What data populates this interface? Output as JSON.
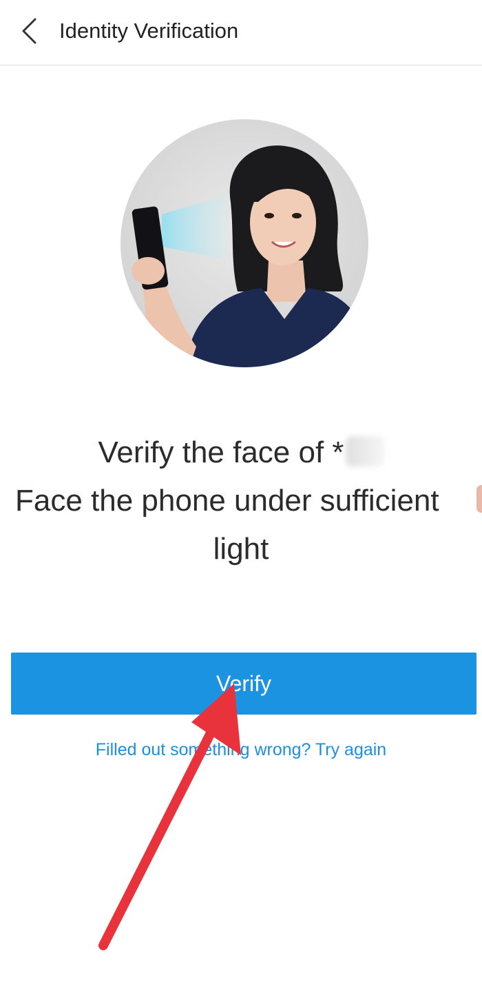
{
  "header": {
    "back_icon": "chevron-left-icon",
    "title": "Identity Verification"
  },
  "illustration": {
    "description_icon": "face-verification-illustration"
  },
  "message": {
    "line1": "Verify the face of *",
    "line2": "Face the phone under sufficient",
    "line3": "light"
  },
  "actions": {
    "verify_label": "Verify",
    "retry_link": "Filled out something wrong? Try again"
  },
  "colors": {
    "accent": "#1c93e0",
    "link": "#1c8fe0",
    "annotation_arrow": "#e8333c"
  }
}
